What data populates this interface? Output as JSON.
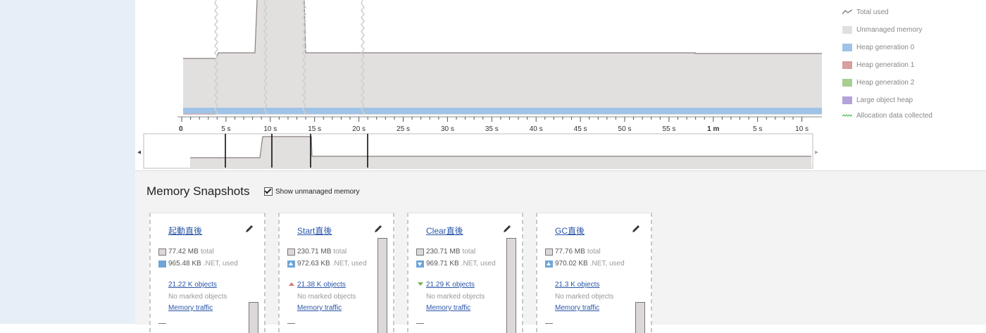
{
  "timeline": {
    "ticks": [
      "0",
      "5 s",
      "10 s",
      "15 s",
      "20 s",
      "25 s",
      "30 s",
      "35 s",
      "40 s",
      "45 s",
      "50 s",
      "55 s",
      "1 m",
      "5 s",
      "10 s"
    ],
    "nav_left": "◂",
    "nav_right": "▸"
  },
  "legend": [
    {
      "label": "Total used",
      "color": "#888888"
    },
    {
      "label": "Unmanaged memory",
      "color": "#e2dfdf"
    },
    {
      "label": "Heap generation 0",
      "color": "#9fc3e6"
    },
    {
      "label": "Heap generation 1",
      "color": "#d99e9e"
    },
    {
      "label": "Heap generation 2",
      "color": "#a8cf90"
    },
    {
      "label": "Large object heap",
      "color": "#b3a3d9"
    },
    {
      "label": "Allocation data collected",
      "color": "#5cc15c"
    }
  ],
  "snapshots_section": {
    "title": "Memory Snapshots",
    "show_unmanaged_label": "Show unmanaged memory",
    "show_unmanaged_checked": true
  },
  "snapshots": [
    {
      "title": "起動直後",
      "total": "77.42 MB",
      "total_suffix": "total",
      "net": "965.48 KB",
      "net_suffix": ".NET, used",
      "objects": "21.22 K objects",
      "marked": "No marked objects",
      "traffic": "Memory traffic"
    },
    {
      "title": "Start直後",
      "total": "230.71 MB",
      "total_suffix": "total",
      "net": "972.63 KB",
      "net_suffix": ".NET, used",
      "objects": "21.38 K objects",
      "marked": "No marked objects",
      "traffic": "Memory traffic"
    },
    {
      "title": "Clear直後",
      "total": "230.71 MB",
      "total_suffix": "total",
      "net": "969.71 KB",
      "net_suffix": ".NET, used",
      "objects": "21.29 K objects",
      "marked": "No marked objects",
      "traffic": "Memory traffic"
    },
    {
      "title": "GC直後",
      "total": "77.76 MB",
      "total_suffix": "total",
      "net": "970.02 KB",
      "net_suffix": ".NET, used",
      "objects": "21.3 K objects",
      "marked": "No marked objects",
      "traffic": "Memory traffic"
    }
  ]
}
